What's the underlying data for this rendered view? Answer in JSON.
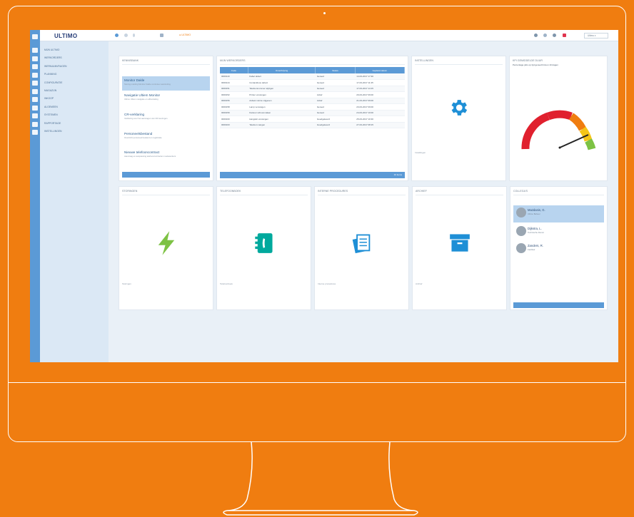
{
  "app": {
    "logo": "ULTIMO"
  },
  "topbar": {
    "breadcrumb": "● ULTIMO",
    "user": "Ultimo ▾"
  },
  "sidebar": {
    "items": [
      "MIJN ULTIMO",
      "WERKORDERS",
      "WERKAANVRAGEN",
      "PLANNING",
      "CONFIGURATIE",
      "MAGAZIJN",
      "INKOOP",
      "ALGEMEEN",
      "SYSTEMEN",
      "RAPPORTAGE",
      "INSTELLINGEN"
    ]
  },
  "knowledge": {
    "title": "KENNISBANK",
    "items": [
      {
        "title": "Monitor Dakle",
        "desc": "Storing melding Monitor Dakle controleer aansluiting"
      },
      {
        "title": "Navigatie Ultiem Monitor",
        "desc": "Ultimo Ultiem navigatie en afhandeling"
      },
      {
        "title": "CR-verklaring",
        "desc": "Verklaring voor het aanvragen van CR keuringen"
      },
      {
        "title": "Personeelsbestand",
        "desc": "Overzicht personeel bestand en registratie"
      },
      {
        "title": "Nieuwe telefooncontract",
        "desc": "Aanvraag en aanpassing telefooncontracten medewerkers"
      }
    ]
  },
  "workorders": {
    "title": "MIJN WERKORDERS",
    "columns": [
      "Code",
      "Omschrijving",
      "Status",
      "Gepland datum"
    ],
    "rows": [
      [
        "0000143",
        "Kabel defect",
        "Gereed",
        "14-03-2017 17:30"
      ],
      [
        "0000144",
        "Contactdoos defect",
        "Gereed",
        "17-03-2017 11:45"
      ],
      [
        "0000151",
        "Telefoonnummer wijzigen",
        "Gereed",
        "17-03-2017 14:15"
      ],
      [
        "0000152",
        "Printer vervangen",
        "Actief",
        "20-03-2017 09:00"
      ],
      [
        "0000156",
        "Asbest ruimte vrijgeven",
        "Actief",
        "21-03-2017 09:00"
      ],
      [
        "0000158",
        "Lamp vervangen",
        "Gereed",
        "23-03-2017 09:00"
      ],
      [
        "0000159",
        "Kantoor schoonmaken",
        "Gereed",
        "24-03-2017 10:00"
      ],
      [
        "0000160",
        "Hangslot vervangen",
        "Goedgekeurd",
        "25-03-2017 10:30"
      ],
      [
        "0000163",
        "Telefoon vangen",
        "Goedgekeurd",
        "27-03-2017 08:15"
      ]
    ],
    "footer": "10 items"
  },
  "settings": {
    "title": "INSTELLINGEN",
    "caption": "Instellingen"
  },
  "gauge": {
    "title": "KPI GEMIDDELDE DUUR",
    "subtitle": "Percentage jobs op tijd gereed binnen 10 dagen"
  },
  "tiles": [
    {
      "title": "STORINGEN",
      "caption": "Storingen",
      "icon": "bolt-icon"
    },
    {
      "title": "TELEFOONBOEK",
      "caption": "Telefoonboek",
      "icon": "phonebook-icon"
    },
    {
      "title": "INTERNE PROCEDURES",
      "caption": "Interne procedures",
      "icon": "documents-icon"
    },
    {
      "title": "ARCHIEF",
      "caption": "Archief",
      "icon": "archive-icon"
    }
  ],
  "colleagues": {
    "title": "COLLEGA'S",
    "items": [
      {
        "name": "Mazdanis, G.",
        "role": "Ultimo Beheer"
      },
      {
        "name": "Dijkstra, L.",
        "role": "Technische Dienst"
      },
      {
        "name": "Zanders, R.",
        "role": "Facilitair"
      }
    ]
  },
  "colors": {
    "orange": "#f07d10",
    "blue": "#5b9ad6",
    "green": "#00a99d",
    "bolt": "#7dc244"
  }
}
